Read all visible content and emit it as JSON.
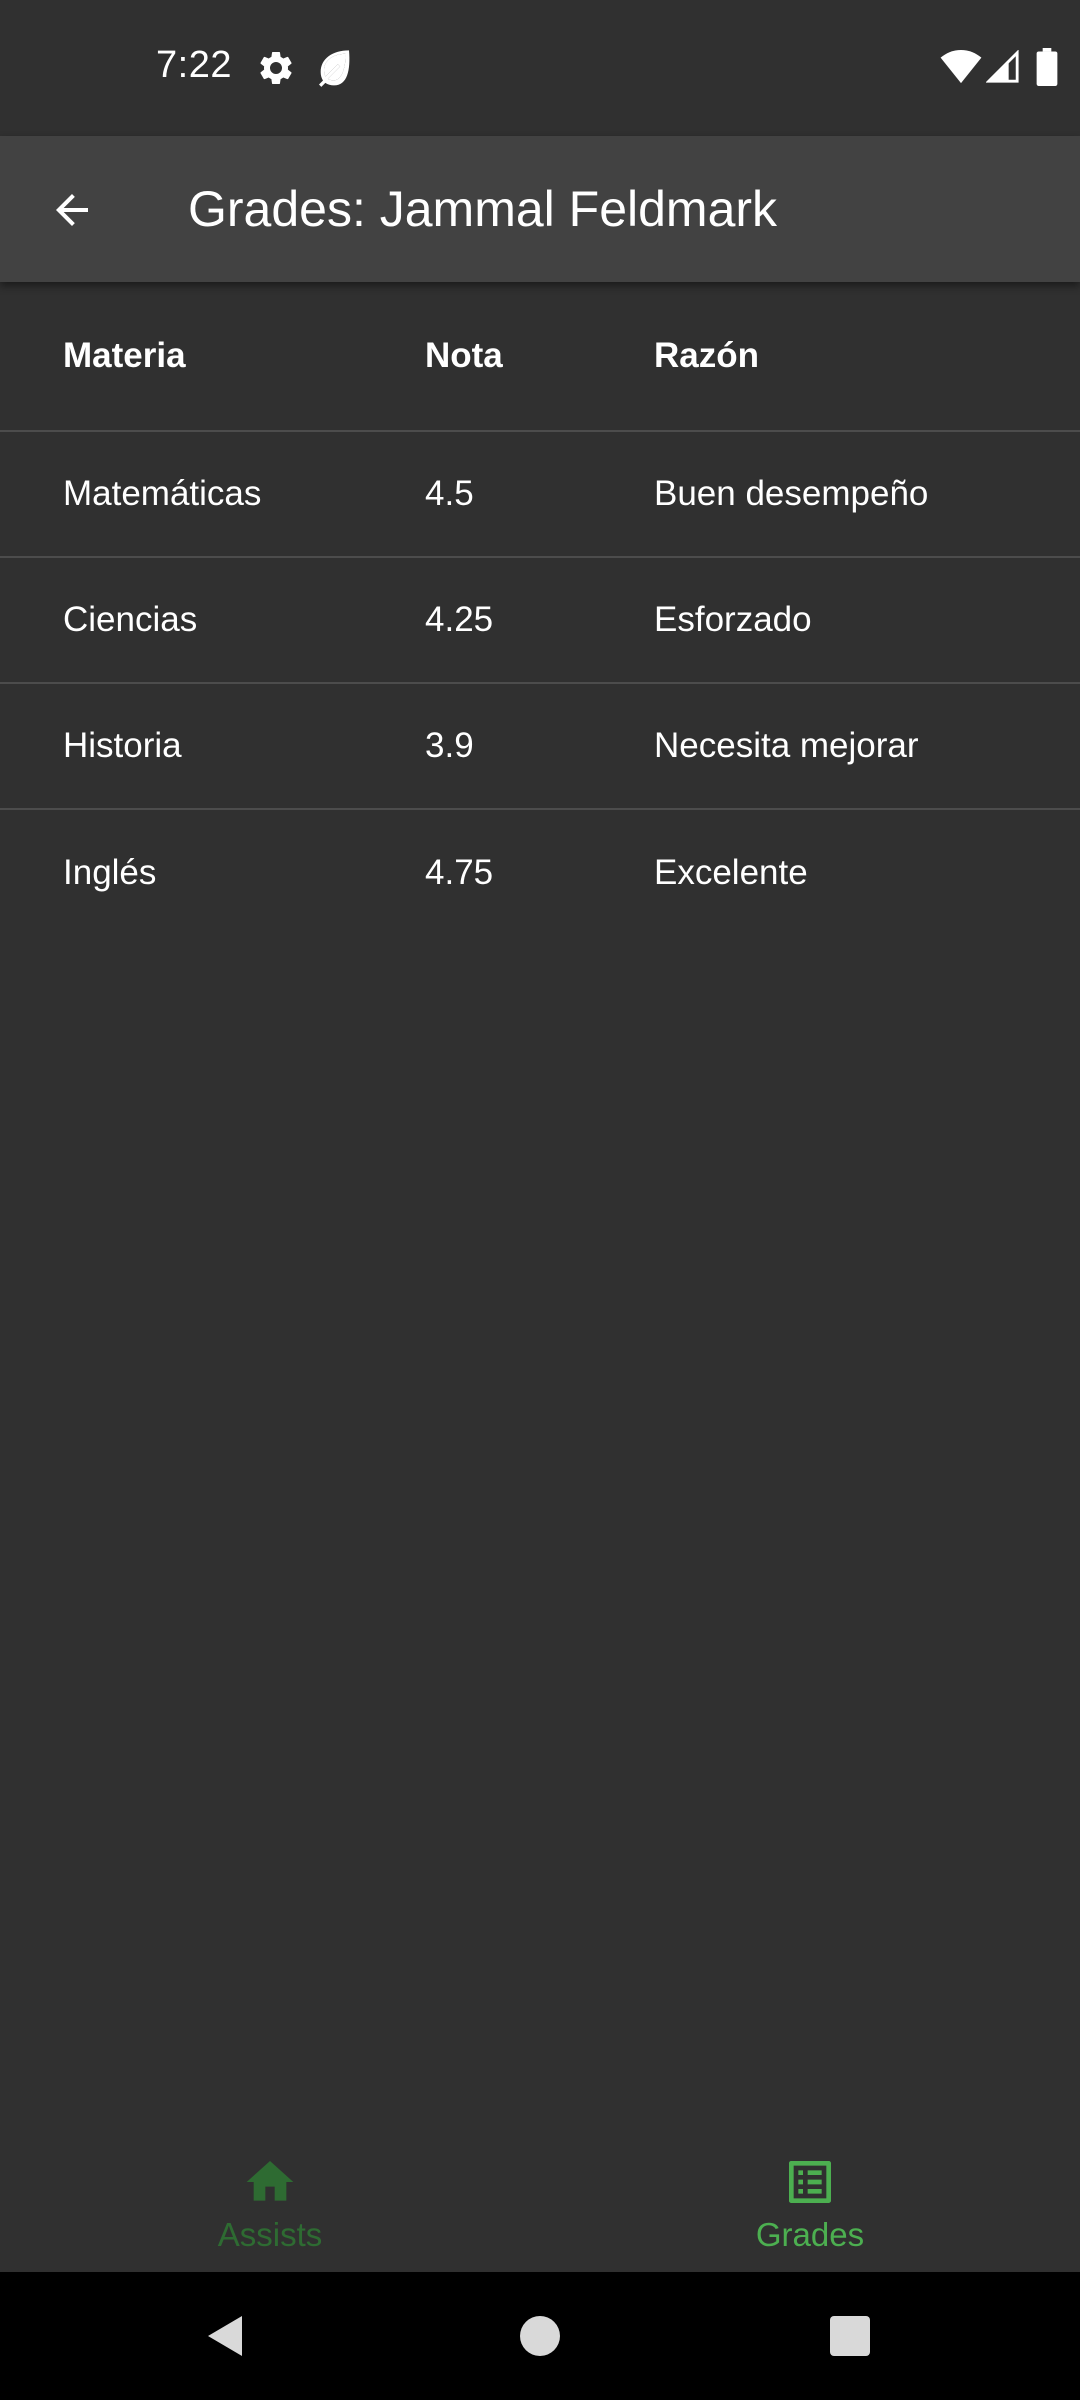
{
  "status_bar": {
    "time": "7:22",
    "icons": [
      "gear-icon",
      "leaf-icon",
      "wifi-icon",
      "signal-icon",
      "battery-icon"
    ]
  },
  "app_bar": {
    "title": "Grades: Jammal Feldmark",
    "back_icon": "arrow-left-icon"
  },
  "table": {
    "headers": [
      "Materia",
      "Nota",
      "Razón"
    ],
    "rows": [
      [
        "Matemáticas",
        "4.5",
        "Buen desempeño"
      ],
      [
        "Ciencias",
        "4.25",
        "Esforzado"
      ],
      [
        "Historia",
        "3.9",
        "Necesita mejorar"
      ],
      [
        "Inglés",
        "4.75",
        "Excelente"
      ]
    ]
  },
  "bottom_nav": {
    "items": [
      {
        "label": "Assists",
        "icon": "home-icon",
        "selected": false
      },
      {
        "label": "Grades",
        "icon": "list-alt-icon",
        "selected": true
      }
    ]
  },
  "colors": {
    "background": "#303030",
    "app_bar": "#424242",
    "accent": "#4CAF50",
    "inactive_nav": "#2E6B32",
    "divider": "#4C4C4C"
  },
  "system_nav": {
    "icons": [
      "back-triangle-icon",
      "home-circle-icon",
      "recents-square-icon"
    ]
  }
}
